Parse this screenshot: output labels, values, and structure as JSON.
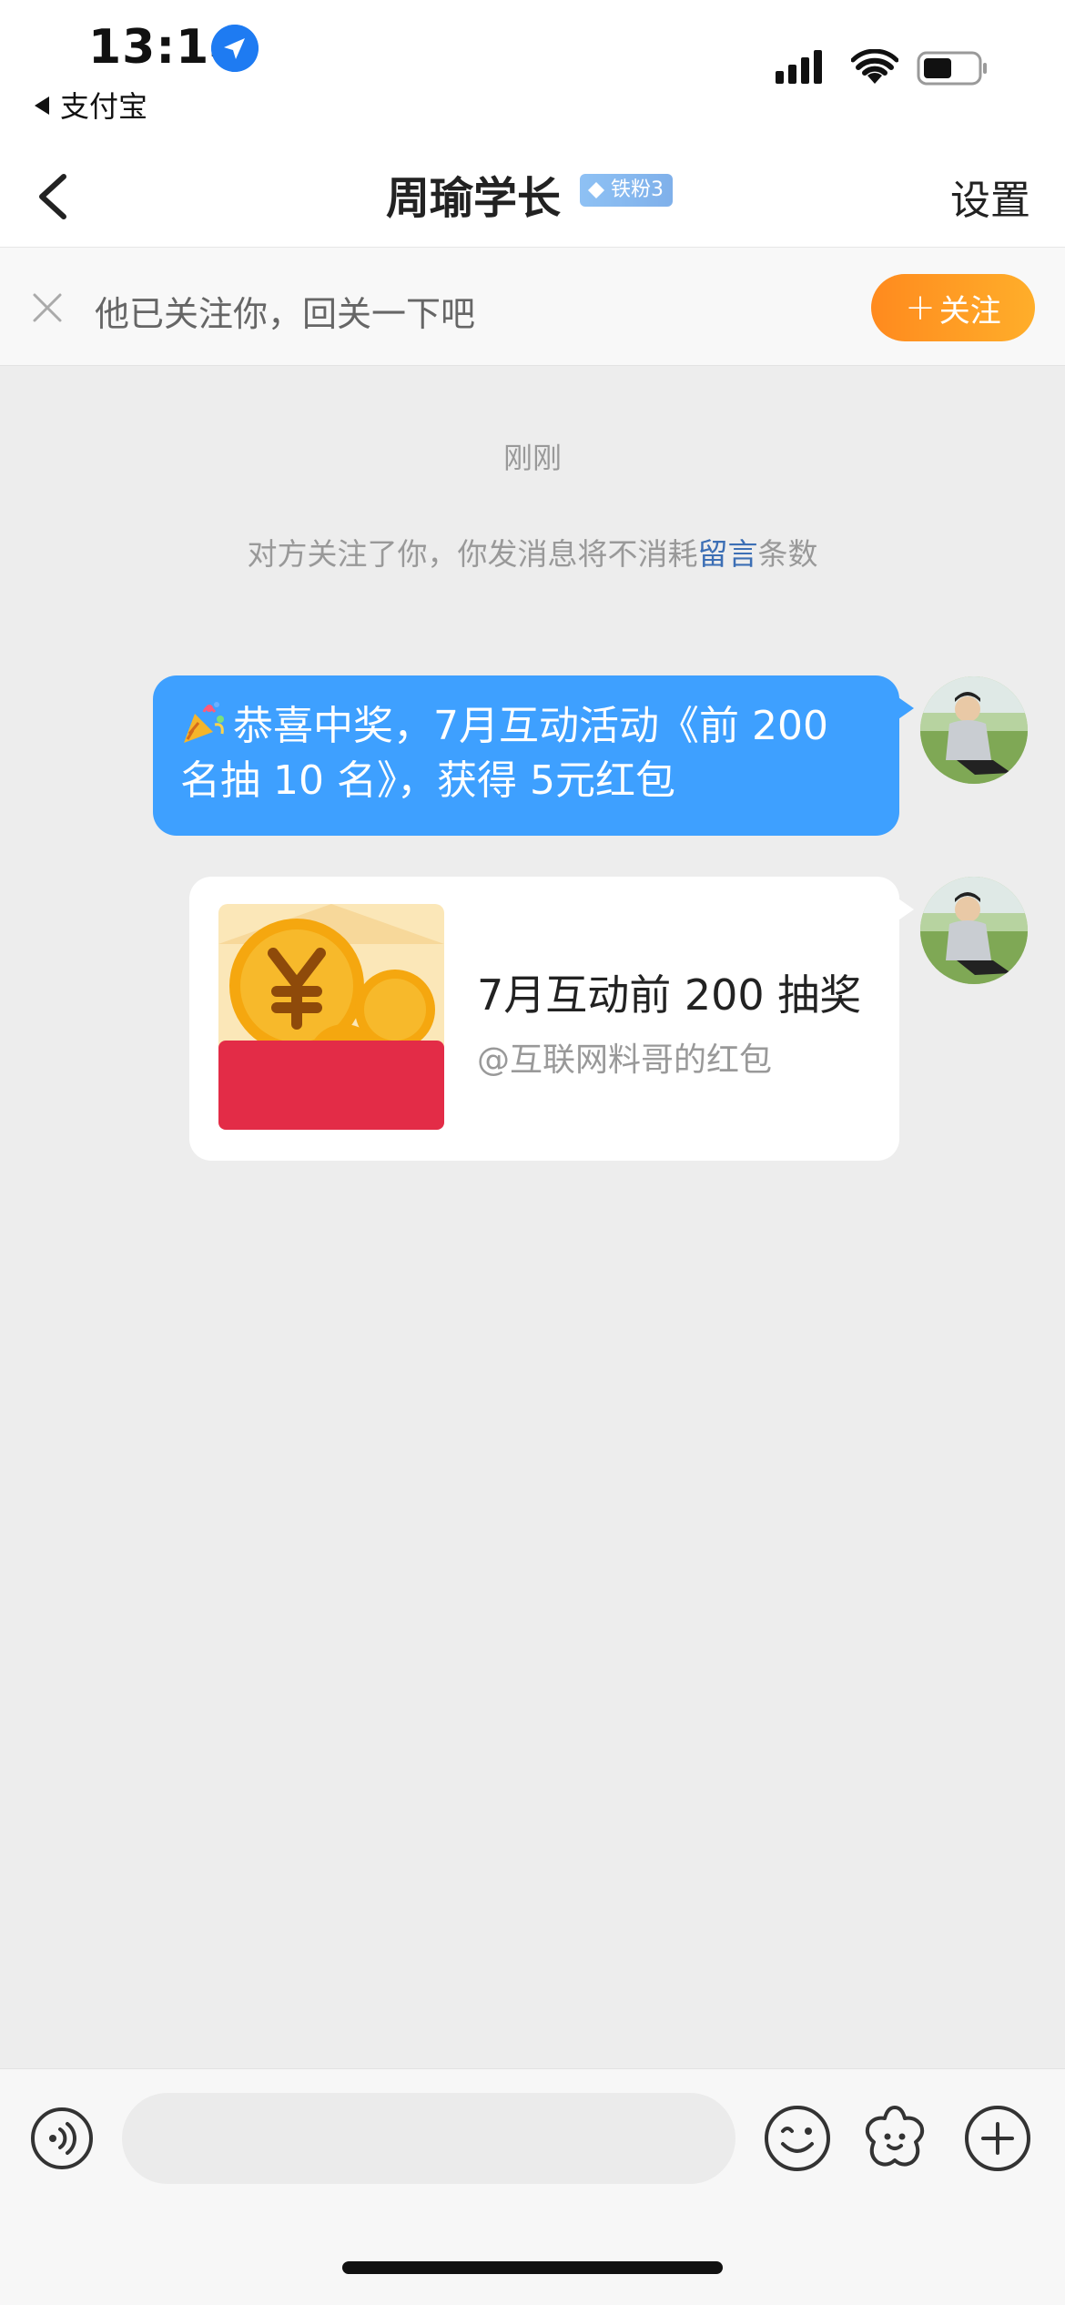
{
  "status_bar": {
    "time": "13:14",
    "back_app": "支付宝",
    "icons": [
      "location-arrow-icon",
      "cellular-signal-icon",
      "wifi-icon",
      "battery-icon"
    ]
  },
  "nav": {
    "back_icon": "chevron-left-icon",
    "title": "周瑜学长",
    "fan_badge": "铁粉3",
    "settings_label": "设置"
  },
  "follow_banner": {
    "text": "他已关注你，回关一下吧",
    "button_label": "关注",
    "button_plus": "+",
    "colors": {
      "button_start": "#ff8a1e",
      "button_end": "#ffae2a"
    }
  },
  "chat": {
    "timestamp": "刚刚",
    "system_notice": {
      "before": "对方关注了你，你发消息将不消耗",
      "link": "留言",
      "after": "条数"
    },
    "messages": [
      {
        "type": "text",
        "line1": "恭喜中奖，7月互动活动《前 200",
        "line2": "名抽 10 名》，获得 5元红包"
      },
      {
        "type": "red_packet",
        "title": "7月互动前 200 抽奖",
        "subtitle": "@互联网料哥的红包"
      }
    ],
    "colors": {
      "bubble": "#3ea0ff",
      "background": "#ededed",
      "red_packet": "#e32c47"
    }
  },
  "input_bar": {
    "placeholder": "",
    "icons": [
      "voice-icon",
      "emoji-icon",
      "sticker-icon",
      "plus-icon"
    ]
  }
}
